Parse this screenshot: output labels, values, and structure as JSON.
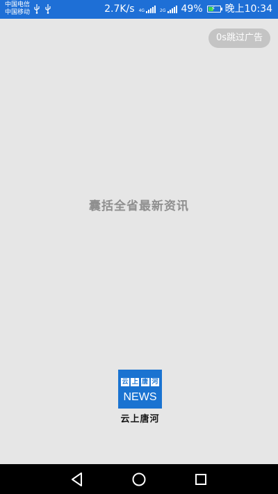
{
  "status_bar": {
    "carrier_1": "中国电信",
    "carrier_2": "中国移动",
    "net_speed": "2.7K/s",
    "sim1_tag": "4G",
    "sim2_tag": "2G",
    "battery_percent": "49%",
    "battery_level": 0.49,
    "time": "晚上10:34",
    "icons": [
      "usb-icon",
      "usb-icon",
      "signal-icon",
      "signal-icon",
      "battery-charging-icon"
    ]
  },
  "splash": {
    "skip_ad_label": "0s跳过广告",
    "slogan": "囊括全省最新资讯"
  },
  "logo": {
    "top_chars": [
      "云",
      "上",
      "唐",
      "河"
    ],
    "news_text": "NEWS",
    "caption": "云上唐河"
  },
  "nav_bar": {
    "icons": [
      "back-icon",
      "home-icon",
      "recent-apps-icon"
    ]
  },
  "colors": {
    "status_bar": "#1e6fd6",
    "background": "#e6e6e6",
    "logo_blue": "#1a73d1",
    "skip_button": "#c4c4c4",
    "battery_fill": "#3bd64a"
  }
}
